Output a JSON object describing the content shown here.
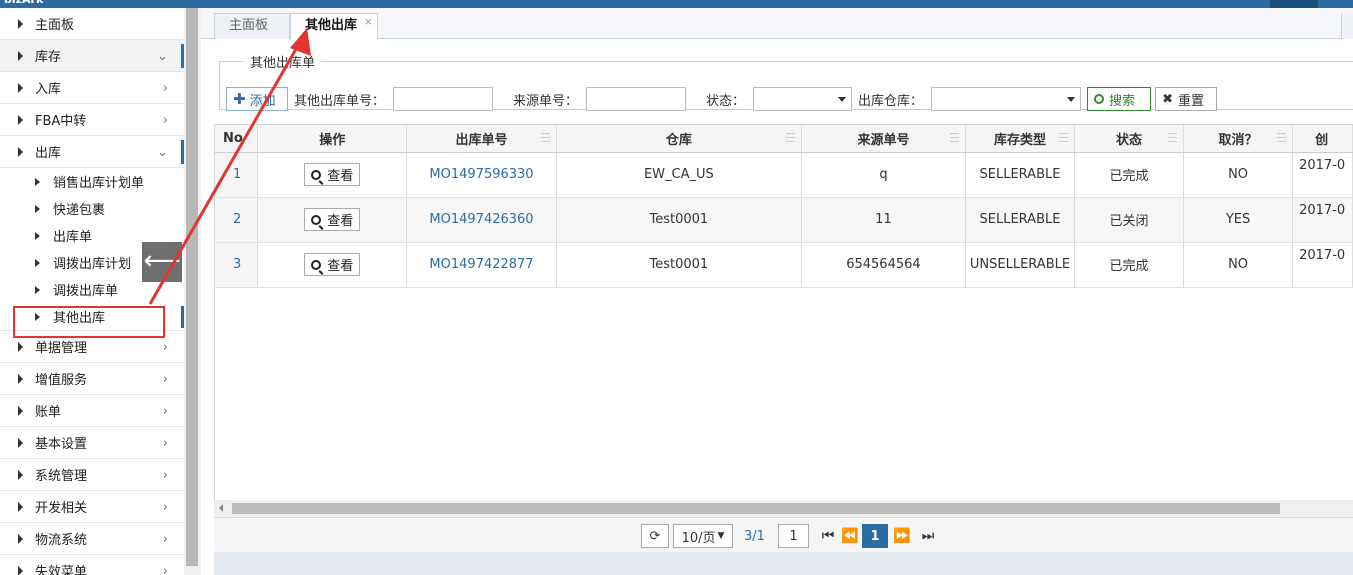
{
  "app": {
    "logo": "bizArk"
  },
  "sidebar": {
    "items": [
      {
        "label": "主面板"
      },
      {
        "label": "库存"
      },
      {
        "label": "入库"
      },
      {
        "label": "FBA中转"
      },
      {
        "label": "出库"
      },
      {
        "label": "单据管理"
      },
      {
        "label": "增值服务"
      },
      {
        "label": "账单"
      },
      {
        "label": "基本设置"
      },
      {
        "label": "系统管理"
      },
      {
        "label": "开发相关"
      },
      {
        "label": "物流系统"
      },
      {
        "label": "失效菜单"
      }
    ],
    "outbound_sub": [
      {
        "label": "销售出库计划单"
      },
      {
        "label": "快递包裹"
      },
      {
        "label": "出库单"
      },
      {
        "label": "调拨出库计划"
      },
      {
        "label": "调拨出库单"
      },
      {
        "label": "其他出库"
      }
    ],
    "collapse_icon": "arrow-left"
  },
  "tabs": [
    {
      "label": "主面板"
    },
    {
      "label": "其他出库",
      "close": "×"
    }
  ],
  "search": {
    "legend": "其他出库单",
    "add_label": "添加",
    "order_no_label": "其他出库单号：",
    "order_no_value": "",
    "source_no_label": "来源单号：",
    "source_no_value": "",
    "status_label": "状态：",
    "status_value": "",
    "warehouse_label": "出库仓库：",
    "warehouse_value": "",
    "search_label": "搜索",
    "reset_label": "重置"
  },
  "table": {
    "columns": [
      "No",
      "操作",
      "出库单号",
      "仓库",
      "来源单号",
      "库存类型",
      "状态",
      "取消？",
      "创"
    ],
    "view_label": "查看",
    "rows": [
      {
        "no": "1",
        "order_no": "MO1497596330",
        "warehouse": "EW_CA_US",
        "source_no": "q",
        "stock_type": "SELLERABLE",
        "status": "已完成",
        "cancel": "NO",
        "created": "2017-0"
      },
      {
        "no": "2",
        "order_no": "MO1497426360",
        "warehouse": "Test0001",
        "source_no": "11",
        "stock_type": "SELLERABLE",
        "status": "已关闭",
        "cancel": "YES",
        "created": "2017-0"
      },
      {
        "no": "3",
        "order_no": "MO1497422877",
        "warehouse": "Test0001",
        "source_no": "654564564",
        "stock_type": "UNSELLERABLE",
        "status": "已完成",
        "cancel": "NO",
        "created": "2017-0"
      }
    ]
  },
  "pager": {
    "page_size": "10/页",
    "page_info": "3/1",
    "page_input": "1",
    "current_page": "1"
  },
  "colors": {
    "accent": "#2d6ca2",
    "annotation": "#e3342f",
    "search_green": "#2d8a2d"
  }
}
